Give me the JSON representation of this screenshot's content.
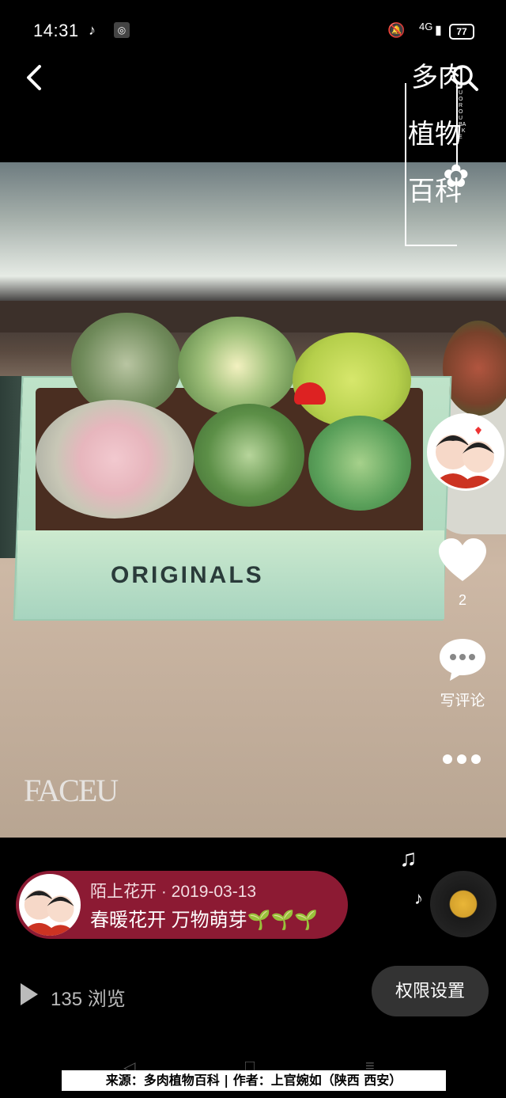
{
  "status_bar": {
    "time": "14:31",
    "network": "4G",
    "battery": "77"
  },
  "photo": {
    "box_brand": "ORIGINALS",
    "watermark": "FACEU"
  },
  "logo": {
    "lines": [
      "多肉",
      "植物",
      "百科"
    ],
    "pinyin": "DUO ROU BAI KE"
  },
  "actions": {
    "likes": "2",
    "comment_label": "写评论"
  },
  "post": {
    "author": "陌上花开",
    "date": "2019-03-13",
    "meta": "陌上花开 · 2019-03-13",
    "title": "春暖花开 万物萌芽🌱🌱🌱"
  },
  "views": {
    "count": "135",
    "label": "135 浏览"
  },
  "permission_button": "权限设置",
  "caption": "来源：多肉植物百科 | 作者：上官婉如（陕西 西安）",
  "colors": {
    "pill_bg": "#8c1a33",
    "perm_bg": "#333333"
  }
}
